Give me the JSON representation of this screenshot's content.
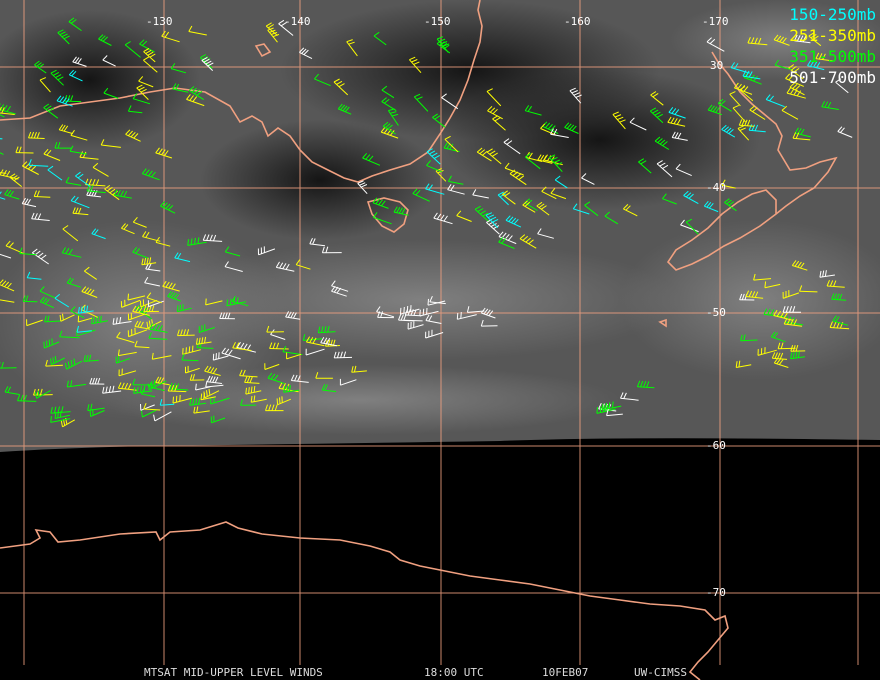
{
  "map": {
    "longitude_labels": [
      "-130",
      "-140",
      "-150",
      "-160",
      "-170"
    ],
    "latitude_labels": [
      "30",
      "-40",
      "-50",
      "-60",
      "-70"
    ]
  },
  "legend": [
    {
      "label": "150-250mb",
      "color": "#00ffff"
    },
    {
      "label": "251-350mb",
      "color": "#ffff00"
    },
    {
      "label": "351-500mb",
      "color": "#00ff00"
    },
    {
      "label": "501-700mb",
      "color": "#ffffff"
    }
  ],
  "footer": {
    "product": "MTSAT MID-UPPER LEVEL WINDS",
    "time": "18:00 UTC",
    "date": "10FEB07",
    "source": "UW-CIMSS"
  },
  "colors": {
    "coastline": "#f0a080",
    "grid": "#f0a080",
    "background": "#000000"
  }
}
